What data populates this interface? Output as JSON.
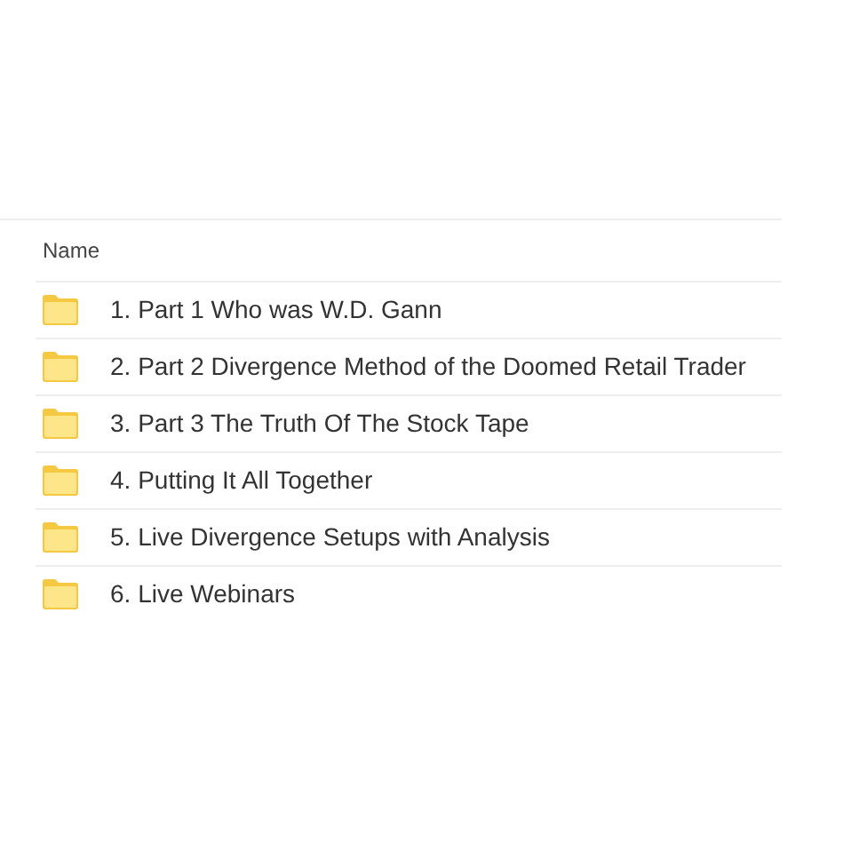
{
  "table": {
    "columns": [
      "Name"
    ],
    "rows": [
      {
        "name": "1. Part 1 Who was W.D. Gann"
      },
      {
        "name": "2. Part 2 Divergence Method of the Doomed Retail Trader"
      },
      {
        "name": "3. Part 3 The Truth Of The Stock Tape"
      },
      {
        "name": "4. Putting It All Together"
      },
      {
        "name": "5. Live Divergence Setups with Analysis"
      },
      {
        "name": "6. Live Webinars"
      }
    ]
  }
}
